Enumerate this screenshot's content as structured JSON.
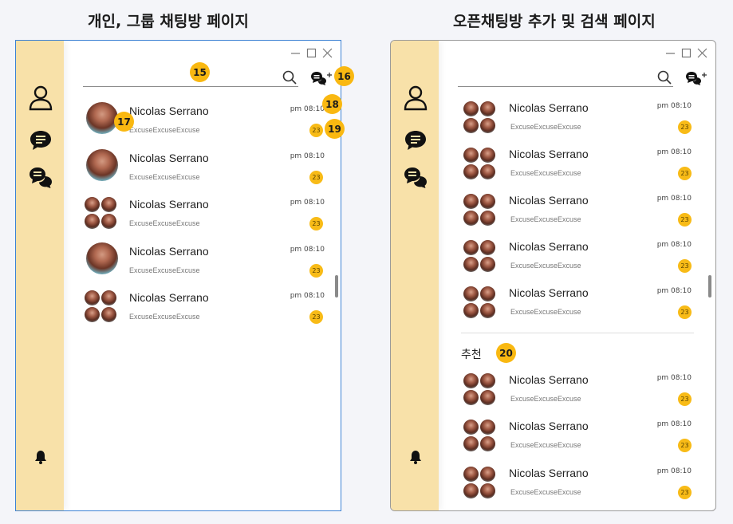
{
  "headings": {
    "left": "개인, 그룹 채팅방 페이지",
    "right": "오픈채팅방 추가 및 검색 페이지"
  },
  "colors": {
    "sidebar": "#f8e1a9",
    "badge": "#f8bb17",
    "marker": "#f9b811",
    "window_border_left": "#3d82d4"
  },
  "icons": {
    "sidebar": [
      "person-icon",
      "chat-bubble-icon",
      "chats-icon",
      "bell-icon"
    ],
    "window": [
      "minimize-icon",
      "maximize-icon",
      "close-icon"
    ],
    "toolbar": [
      "search-icon",
      "new-chat-icon"
    ]
  },
  "left_panel": {
    "search_placeholder": "",
    "chats": [
      {
        "name": "Nicolas Serrano",
        "message": "ExcuseExcuseExcuse",
        "time": "pm 08:10",
        "unread": "23",
        "avatar": "single"
      },
      {
        "name": "Nicolas Serrano",
        "message": "ExcuseExcuseExcuse",
        "time": "pm 08:10",
        "unread": "23",
        "avatar": "single"
      },
      {
        "name": "Nicolas Serrano",
        "message": "ExcuseExcuseExcuse",
        "time": "pm 08:10",
        "unread": "23",
        "avatar": "group"
      },
      {
        "name": "Nicolas Serrano",
        "message": "ExcuseExcuseExcuse",
        "time": "pm 08:10",
        "unread": "23",
        "avatar": "single"
      },
      {
        "name": "Nicolas Serrano",
        "message": "ExcuseExcuseExcuse",
        "time": "pm 08:10",
        "unread": "23",
        "avatar": "group"
      }
    ],
    "markers": [
      "15",
      "16",
      "17",
      "18",
      "19"
    ]
  },
  "right_panel": {
    "search_placeholder": "",
    "chats": [
      {
        "name": "Nicolas Serrano",
        "message": "ExcuseExcuseExcuse",
        "time": "pm 08:10",
        "unread": "23"
      },
      {
        "name": "Nicolas Serrano",
        "message": "ExcuseExcuseExcuse",
        "time": "pm 08:10",
        "unread": "23"
      },
      {
        "name": "Nicolas Serrano",
        "message": "ExcuseExcuseExcuse",
        "time": "pm 08:10",
        "unread": "23"
      },
      {
        "name": "Nicolas Serrano",
        "message": "ExcuseExcuseExcuse",
        "time": "pm 08:10",
        "unread": "23"
      },
      {
        "name": "Nicolas Serrano",
        "message": "ExcuseExcuseExcuse",
        "time": "pm 08:10",
        "unread": "23"
      }
    ],
    "recommended_title": "추천",
    "recommended": [
      {
        "name": "Nicolas Serrano",
        "message": "ExcuseExcuseExcuse",
        "time": "pm 08:10",
        "unread": "23"
      },
      {
        "name": "Nicolas Serrano",
        "message": "ExcuseExcuseExcuse",
        "time": "pm 08:10",
        "unread": "23"
      },
      {
        "name": "Nicolas Serrano",
        "message": "ExcuseExcuseExcuse",
        "time": "pm 08:10",
        "unread": "23"
      }
    ],
    "markers": [
      "20"
    ]
  }
}
